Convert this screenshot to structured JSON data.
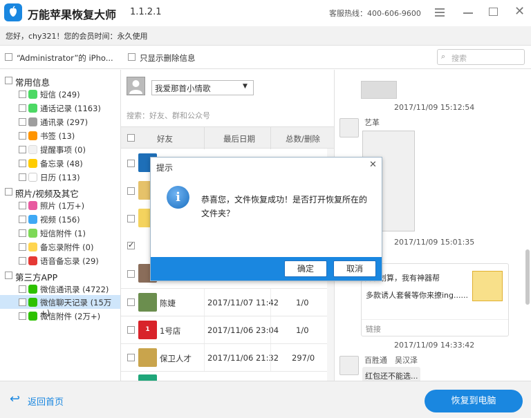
{
  "app": {
    "title": "万能苹果恢复大师",
    "version": "1.1.2.1",
    "hotline": "客服热线：400-606-9600",
    "greeting": "您好，chy321！您的会员时间：永久使用"
  },
  "toolbar": {
    "device_label": "“Administrator”的 iPho...",
    "only_deleted_label": "只显示删除信息",
    "search_placeholder": "搜索"
  },
  "sidebar": {
    "groups": [
      {
        "label": "常用信息"
      },
      {
        "label": "照片/视频及其它"
      },
      {
        "label": "第三方APP"
      }
    ],
    "items": [
      {
        "label": "短信 (249)",
        "color": "#4cd964"
      },
      {
        "label": "通话记录 (1163)",
        "color": "#4cd964"
      },
      {
        "label": "通讯录 (297)",
        "color": "#9e9e9e"
      },
      {
        "label": "书签 (13)",
        "color": "#ff9500"
      },
      {
        "label": "提醒事项 (0)",
        "color": "#dddddd"
      },
      {
        "label": "备忘录 (48)",
        "color": "#ffcc00"
      },
      {
        "label": "日历 (113)",
        "color": "#f2f2f2"
      },
      {
        "label": "照片 (1万+)",
        "color": "#e85aa0"
      },
      {
        "label": "视频 (156)",
        "color": "#3fa9f5"
      },
      {
        "label": "短信附件 (1)",
        "color": "#7ed957"
      },
      {
        "label": "备忘录附件 (0)",
        "color": "#ffd54f"
      },
      {
        "label": "语音备忘录 (29)",
        "color": "#e53935"
      },
      {
        "label": "微信通讯录 (4722)",
        "color": "#2dc100"
      },
      {
        "label": "微信聊天记录 (15万+)",
        "color": "#2dc100"
      },
      {
        "label": "微信附件 (2万+)",
        "color": "#2dc100"
      }
    ]
  },
  "middle": {
    "account_selected": "我爱那首小情歌",
    "search_placeholder": "搜索：好友、群和公众号",
    "columns": [
      "好友",
      "最后日期",
      "总数/删除"
    ],
    "rows": [
      {
        "name": "陈婕",
        "date": "2017/11/07 11:42",
        "count": "1/0"
      },
      {
        "name": "1号店",
        "date": "2017/11/06 23:04",
        "count": "1/0"
      },
      {
        "name": "保卫人才",
        "date": "2017/11/06 21:32",
        "count": "297/0"
      }
    ]
  },
  "chat": {
    "timestamps": [
      "2017/11/09 15:12:54",
      "2017/11/09 15:01:35",
      "2017/11/09 14:33:42"
    ],
    "sender1": "艺革",
    "link_text1": "套餐最划算，我有神器帮",
    "link_text2": "多款诱人套餐等你来撩ing......",
    "link_label": "链接",
    "sender2": "百胜通　吴汉泽",
    "bubble": "红包还不能选..."
  },
  "dialog": {
    "title": "提示",
    "message_line1": "恭喜您，文件恢复成功！是否打开恢复所在的",
    "message_line2": "文件夹？",
    "confirm": "确定",
    "cancel": "取消"
  },
  "footer": {
    "back_label": "返回首页",
    "recover_label": "恢复到电脑"
  },
  "colors": {
    "accent": "#1a87e0",
    "dialog_bar": "#1a87e0"
  }
}
